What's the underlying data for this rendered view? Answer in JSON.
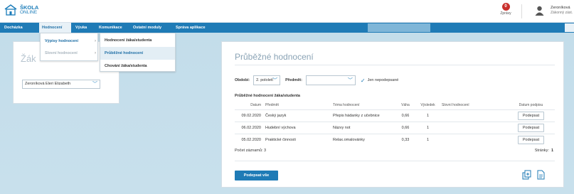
{
  "header": {
    "logo_line1": "ŠKOLA",
    "logo_line2": "ONLINE",
    "messages_count": "0",
    "messages_label": "Zprávy",
    "user_name": "Zeroníková",
    "user_role": "Zákonný zást."
  },
  "nav": {
    "items": [
      {
        "label": "Docházka"
      },
      {
        "label": "Hodnocení"
      },
      {
        "label": "Výuka"
      },
      {
        "label": "Komunikace"
      },
      {
        "label": "Ostatní moduly"
      },
      {
        "label": "Správa aplikace"
      }
    ]
  },
  "left_card": {
    "title": "Žák",
    "student_select": "Zeroníková Eleri Elizabeth"
  },
  "menu_level1": {
    "items": [
      {
        "label": "Výpisy hodnocení"
      },
      {
        "label": "Slovní hodnocení"
      }
    ]
  },
  "menu_level2": {
    "items": [
      {
        "label": "Hodnocení žáka/studenta"
      },
      {
        "label": "Průběžné hodnocení"
      },
      {
        "label": "Chování žáka/studenta"
      }
    ]
  },
  "main": {
    "title": "Průběžné hodnocení",
    "filters": {
      "period_label": "Období:",
      "period_value": "2. pololetí",
      "subject_label": "Předmět:",
      "subject_value": "",
      "unsigned_label": "Jen nepodepsané"
    },
    "section_title": "Průběžné hodnocení žáka/studenta",
    "columns": {
      "date": "Datum",
      "subject": "Předmět",
      "topic": "Téma hodnocení",
      "weight": "Váha",
      "result": "Výsledek",
      "verbal": "Slovní hodnocení",
      "sign_date": "Datum podpisu"
    },
    "rows": [
      {
        "date": "09.02.2020",
        "subject": "Český jazyk",
        "topic": "Přepis hádanky z učebnice",
        "weight": "0,66",
        "result": "1",
        "verbal": "",
        "sign": "Podepsat"
      },
      {
        "date": "06.02.2020",
        "subject": "Hudební výchova",
        "topic": "Názvy not",
        "weight": "0,66",
        "result": "1",
        "verbal": "",
        "sign": "Podepsat"
      },
      {
        "date": "05.02.2020",
        "subject": "Praktické činnosti",
        "topic": "Relax.omalovánky",
        "weight": "0,33",
        "result": "1",
        "verbal": "",
        "sign": "Podepsat"
      }
    ],
    "records_label": "Počet záznamů: 3",
    "pages_label": "Stránky:",
    "pages_value": "1",
    "sign_all": "Podepsat vše"
  },
  "colors": {
    "accent": "#1f7bb6",
    "badge": "#c9302c"
  }
}
